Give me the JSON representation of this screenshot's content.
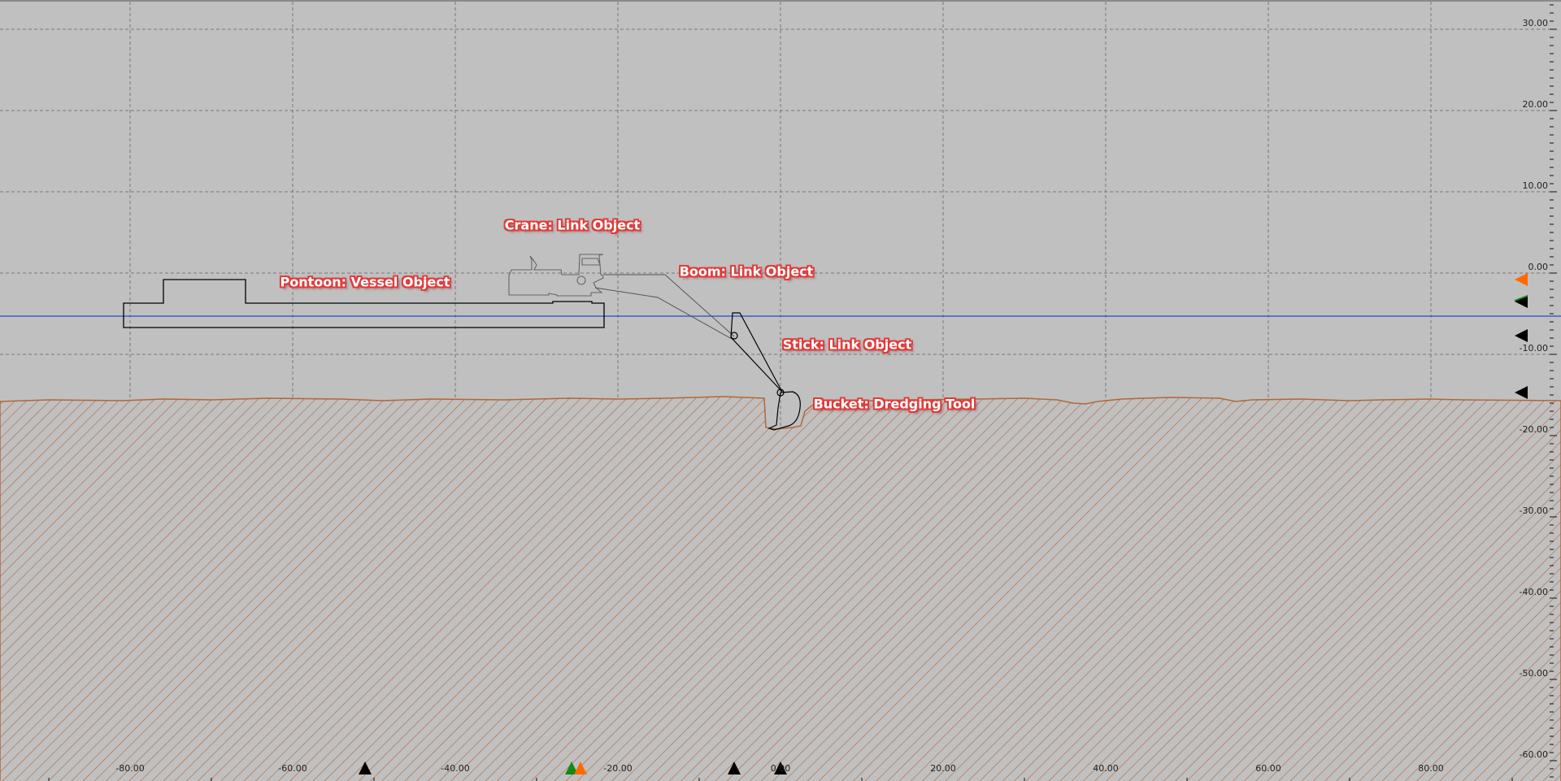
{
  "axes": {
    "x_labels": [
      "-80.00",
      "-60.00",
      "-40.00",
      "-20.00",
      "0.00",
      "20.00",
      "40.00",
      "60.00",
      "80.00"
    ],
    "x_values": [
      -80,
      -60,
      -40,
      -20,
      0,
      20,
      40,
      60,
      80
    ],
    "y_labels": [
      "30.00",
      "20.00",
      "10.00",
      "0.00",
      "-10.00",
      "-20.00",
      "-30.00",
      "-40.00",
      "-50.00",
      "-60.00"
    ],
    "y_values": [
      30,
      20,
      10,
      0,
      -10,
      -20,
      -30,
      -40,
      -50,
      -60
    ]
  },
  "water_level": -5.3,
  "annotations": {
    "crane": "Crane: Link Object",
    "pontoon": "Pontoon: Vessel Object",
    "boom": "Boom: Link Object",
    "stick": "Stick: Link Object",
    "bucket": "Bucket: Dredging Tool"
  },
  "colors": {
    "background": "#c0c0c0",
    "water": "#1f4fbf",
    "seabed": "#b0683a",
    "marker_orange": "#ff6a00",
    "marker_green": "#138a13",
    "marker_black": "#000000"
  },
  "markers_right": [
    {
      "level": -0.8,
      "color": "#ff6a00"
    },
    {
      "level": -3.5,
      "color": "#000000",
      "accent": "#138a13"
    },
    {
      "level": -7.7,
      "color": "#000000"
    },
    {
      "level": -14.7,
      "color": "#000000"
    }
  ],
  "markers_bottom": [
    {
      "pos": -51.1,
      "color": "#000000"
    },
    {
      "pos": -25.7,
      "color": "#138a13"
    },
    {
      "pos": -24.6,
      "color": "#ff6a00"
    },
    {
      "pos": -5.7,
      "color": "#000000"
    },
    {
      "pos": 0,
      "color": "#000000"
    }
  ]
}
